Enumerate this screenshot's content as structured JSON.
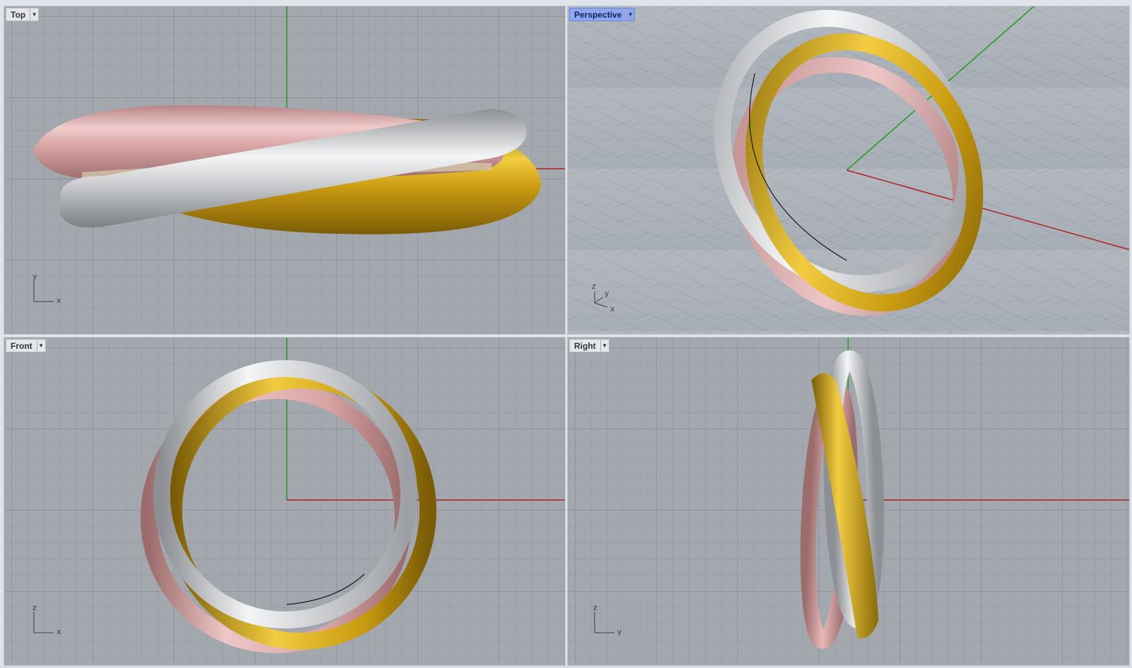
{
  "viewports": {
    "top": {
      "label": "Top",
      "axes": {
        "vertical": "y",
        "horizontal": "x"
      }
    },
    "perspective": {
      "label": "Perspective",
      "axes": {
        "z": "z",
        "y": "y",
        "x": "x"
      }
    },
    "front": {
      "label": "Front",
      "axes": {
        "vertical": "z",
        "horizontal": "x"
      }
    },
    "right": {
      "label": "Right",
      "axes": {
        "vertical": "z",
        "horizontal": "y"
      }
    }
  },
  "icons": {
    "dropdown": "chevron-down-icon"
  },
  "colors": {
    "viewport_bg": "#a3a7ae",
    "grid_major": "#8f949c",
    "grid_minor": "#9a9ea5",
    "axis_x": "#b02020",
    "axis_y": "#18a018",
    "ring_rose": "#d8a4a4",
    "ring_gold": "#c89a10",
    "ring_white": "#d2d4d6",
    "active_label": "#8ea7ee"
  }
}
